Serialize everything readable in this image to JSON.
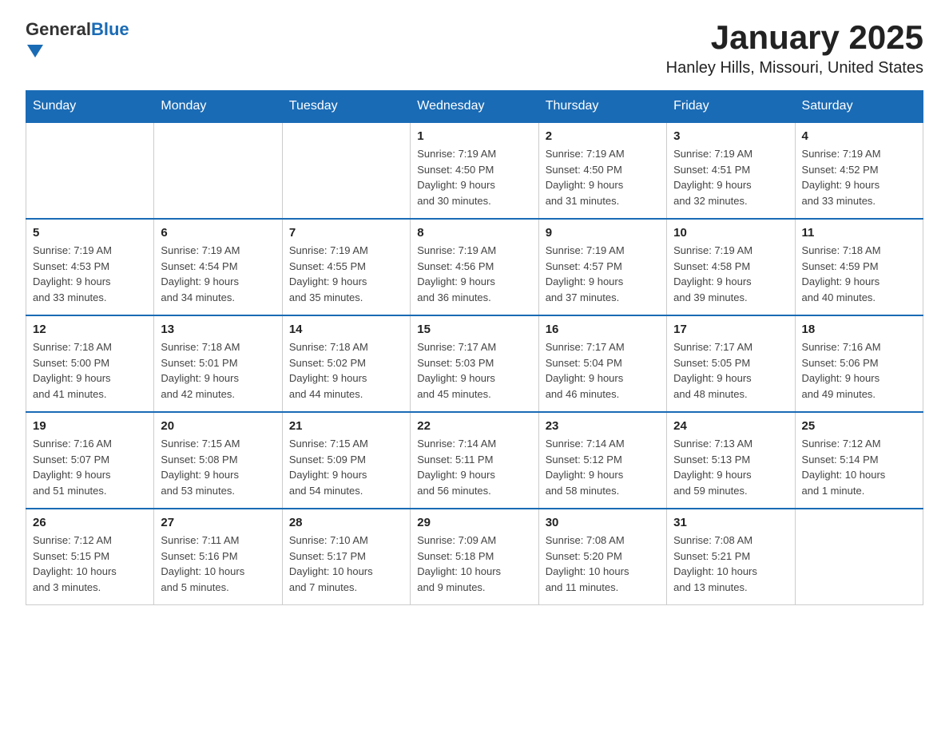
{
  "header": {
    "logo_general": "General",
    "logo_blue": "Blue",
    "title": "January 2025",
    "subtitle": "Hanley Hills, Missouri, United States"
  },
  "days_of_week": [
    "Sunday",
    "Monday",
    "Tuesday",
    "Wednesday",
    "Thursday",
    "Friday",
    "Saturday"
  ],
  "weeks": [
    [
      {
        "day": "",
        "info": ""
      },
      {
        "day": "",
        "info": ""
      },
      {
        "day": "",
        "info": ""
      },
      {
        "day": "1",
        "info": "Sunrise: 7:19 AM\nSunset: 4:50 PM\nDaylight: 9 hours\nand 30 minutes."
      },
      {
        "day": "2",
        "info": "Sunrise: 7:19 AM\nSunset: 4:50 PM\nDaylight: 9 hours\nand 31 minutes."
      },
      {
        "day": "3",
        "info": "Sunrise: 7:19 AM\nSunset: 4:51 PM\nDaylight: 9 hours\nand 32 minutes."
      },
      {
        "day": "4",
        "info": "Sunrise: 7:19 AM\nSunset: 4:52 PM\nDaylight: 9 hours\nand 33 minutes."
      }
    ],
    [
      {
        "day": "5",
        "info": "Sunrise: 7:19 AM\nSunset: 4:53 PM\nDaylight: 9 hours\nand 33 minutes."
      },
      {
        "day": "6",
        "info": "Sunrise: 7:19 AM\nSunset: 4:54 PM\nDaylight: 9 hours\nand 34 minutes."
      },
      {
        "day": "7",
        "info": "Sunrise: 7:19 AM\nSunset: 4:55 PM\nDaylight: 9 hours\nand 35 minutes."
      },
      {
        "day": "8",
        "info": "Sunrise: 7:19 AM\nSunset: 4:56 PM\nDaylight: 9 hours\nand 36 minutes."
      },
      {
        "day": "9",
        "info": "Sunrise: 7:19 AM\nSunset: 4:57 PM\nDaylight: 9 hours\nand 37 minutes."
      },
      {
        "day": "10",
        "info": "Sunrise: 7:19 AM\nSunset: 4:58 PM\nDaylight: 9 hours\nand 39 minutes."
      },
      {
        "day": "11",
        "info": "Sunrise: 7:18 AM\nSunset: 4:59 PM\nDaylight: 9 hours\nand 40 minutes."
      }
    ],
    [
      {
        "day": "12",
        "info": "Sunrise: 7:18 AM\nSunset: 5:00 PM\nDaylight: 9 hours\nand 41 minutes."
      },
      {
        "day": "13",
        "info": "Sunrise: 7:18 AM\nSunset: 5:01 PM\nDaylight: 9 hours\nand 42 minutes."
      },
      {
        "day": "14",
        "info": "Sunrise: 7:18 AM\nSunset: 5:02 PM\nDaylight: 9 hours\nand 44 minutes."
      },
      {
        "day": "15",
        "info": "Sunrise: 7:17 AM\nSunset: 5:03 PM\nDaylight: 9 hours\nand 45 minutes."
      },
      {
        "day": "16",
        "info": "Sunrise: 7:17 AM\nSunset: 5:04 PM\nDaylight: 9 hours\nand 46 minutes."
      },
      {
        "day": "17",
        "info": "Sunrise: 7:17 AM\nSunset: 5:05 PM\nDaylight: 9 hours\nand 48 minutes."
      },
      {
        "day": "18",
        "info": "Sunrise: 7:16 AM\nSunset: 5:06 PM\nDaylight: 9 hours\nand 49 minutes."
      }
    ],
    [
      {
        "day": "19",
        "info": "Sunrise: 7:16 AM\nSunset: 5:07 PM\nDaylight: 9 hours\nand 51 minutes."
      },
      {
        "day": "20",
        "info": "Sunrise: 7:15 AM\nSunset: 5:08 PM\nDaylight: 9 hours\nand 53 minutes."
      },
      {
        "day": "21",
        "info": "Sunrise: 7:15 AM\nSunset: 5:09 PM\nDaylight: 9 hours\nand 54 minutes."
      },
      {
        "day": "22",
        "info": "Sunrise: 7:14 AM\nSunset: 5:11 PM\nDaylight: 9 hours\nand 56 minutes."
      },
      {
        "day": "23",
        "info": "Sunrise: 7:14 AM\nSunset: 5:12 PM\nDaylight: 9 hours\nand 58 minutes."
      },
      {
        "day": "24",
        "info": "Sunrise: 7:13 AM\nSunset: 5:13 PM\nDaylight: 9 hours\nand 59 minutes."
      },
      {
        "day": "25",
        "info": "Sunrise: 7:12 AM\nSunset: 5:14 PM\nDaylight: 10 hours\nand 1 minute."
      }
    ],
    [
      {
        "day": "26",
        "info": "Sunrise: 7:12 AM\nSunset: 5:15 PM\nDaylight: 10 hours\nand 3 minutes."
      },
      {
        "day": "27",
        "info": "Sunrise: 7:11 AM\nSunset: 5:16 PM\nDaylight: 10 hours\nand 5 minutes."
      },
      {
        "day": "28",
        "info": "Sunrise: 7:10 AM\nSunset: 5:17 PM\nDaylight: 10 hours\nand 7 minutes."
      },
      {
        "day": "29",
        "info": "Sunrise: 7:09 AM\nSunset: 5:18 PM\nDaylight: 10 hours\nand 9 minutes."
      },
      {
        "day": "30",
        "info": "Sunrise: 7:08 AM\nSunset: 5:20 PM\nDaylight: 10 hours\nand 11 minutes."
      },
      {
        "day": "31",
        "info": "Sunrise: 7:08 AM\nSunset: 5:21 PM\nDaylight: 10 hours\nand 13 minutes."
      },
      {
        "day": "",
        "info": ""
      }
    ]
  ]
}
